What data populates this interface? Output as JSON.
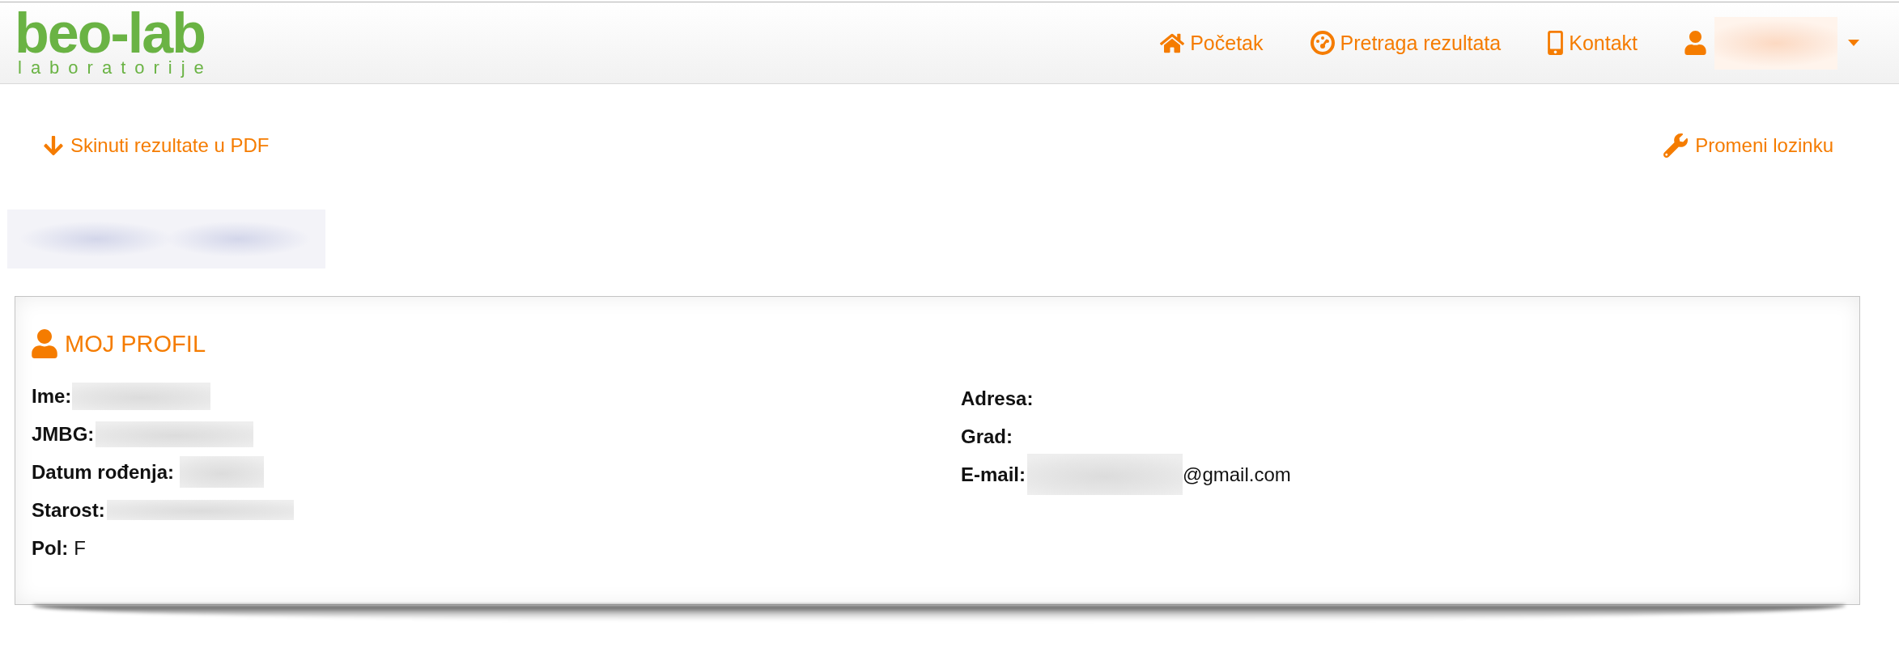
{
  "header": {
    "logo": {
      "wordmark": "beo-lab",
      "tagline": "laboratorije"
    },
    "nav": [
      {
        "kind": "home",
        "label": "Početak"
      },
      {
        "kind": "gauge",
        "label": "Pretraga rezultata"
      },
      {
        "kind": "phone",
        "label": "Kontakt"
      }
    ],
    "user_menu": {
      "name_blurred": true
    }
  },
  "actions": [
    {
      "kind": "download",
      "label": "Skinuti rezultate u PDF"
    },
    {
      "kind": "password",
      "label": "Promeni lozinku"
    }
  ],
  "heading": {
    "blurred": true
  },
  "profile": {
    "title": "MOJ PROFIL",
    "columns": [
      [
        {
          "label": "Ime:",
          "blurred": true
        },
        {
          "label": "JMBG:",
          "blurred": true
        },
        {
          "label": "Datum rođenja:",
          "blurred": true
        },
        {
          "label": "Starost:",
          "blurred": true
        },
        {
          "label": "Pol:",
          "value": "F"
        }
      ],
      [
        {
          "label": "Adresa:"
        },
        {
          "label": "Grad:"
        },
        {
          "label": "E-mail:",
          "blurred": true,
          "value": "@gmail.com"
        }
      ]
    ]
  }
}
